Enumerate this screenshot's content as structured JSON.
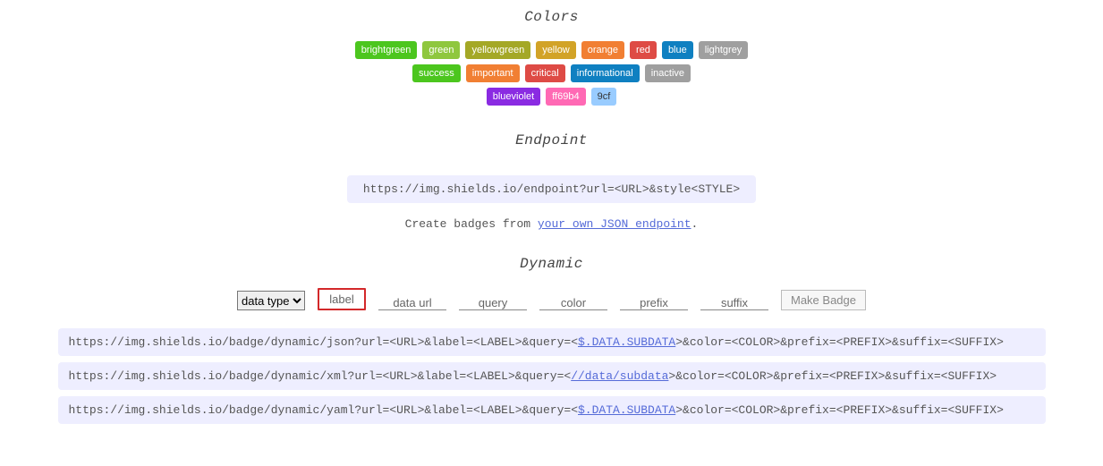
{
  "sections": {
    "colors": {
      "title": "Colors",
      "rows": [
        [
          {
            "label": "brightgreen",
            "bg": "#4cc61e"
          },
          {
            "label": "green",
            "bg": "#8fc73e"
          },
          {
            "label": "yellowgreen",
            "bg": "#a4a826"
          },
          {
            "label": "yellow",
            "bg": "#d2a327"
          },
          {
            "label": "orange",
            "bg": "#f17f33"
          },
          {
            "label": "red",
            "bg": "#de4b45"
          },
          {
            "label": "blue",
            "bg": "#0f80c1"
          },
          {
            "label": "lightgrey",
            "bg": "#9f9f9f"
          }
        ],
        [
          {
            "label": "success",
            "bg": "#4cc61e"
          },
          {
            "label": "important",
            "bg": "#f17f33"
          },
          {
            "label": "critical",
            "bg": "#de4b45"
          },
          {
            "label": "informational",
            "bg": "#0f80c1"
          },
          {
            "label": "inactive",
            "bg": "#9f9f9f"
          }
        ],
        [
          {
            "label": "blueviolet",
            "bg": "#8a2be2"
          },
          {
            "label": "ff69b4",
            "bg": "#ff69b4"
          },
          {
            "label": "9cf",
            "bg": "#99ccff",
            "dark": true
          }
        ]
      ]
    },
    "endpoint": {
      "title": "Endpoint",
      "url": "https://img.shields.io/endpoint?url=<URL>&style<STYLE>",
      "desc_pre": "Create badges from ",
      "desc_link": "your own JSON endpoint",
      "desc_post": "."
    },
    "dynamic": {
      "title": "Dynamic",
      "select_label": "data type",
      "inputs": {
        "label": "label",
        "dataurl": "data url",
        "query": "query",
        "color": "color",
        "prefix": "prefix",
        "suffix": "suffix"
      },
      "button": "Make Badge",
      "urls": [
        {
          "pre": "https://img.shields.io/badge/dynamic/json?url=<URL>&label=<LABEL>&query=<",
          "link": "$.DATA.SUBDATA",
          "post": ">&color=<COLOR>&prefix=<PREFIX>&suffix=<SUFFIX>"
        },
        {
          "pre": "https://img.shields.io/badge/dynamic/xml?url=<URL>&label=<LABEL>&query=<",
          "link": "//data/subdata",
          "post": ">&color=<COLOR>&prefix=<PREFIX>&suffix=<SUFFIX>"
        },
        {
          "pre": "https://img.shields.io/badge/dynamic/yaml?url=<URL>&label=<LABEL>&query=<",
          "link": "$.DATA.SUBDATA",
          "post": ">&color=<COLOR>&prefix=<PREFIX>&suffix=<SUFFIX>"
        }
      ]
    }
  }
}
